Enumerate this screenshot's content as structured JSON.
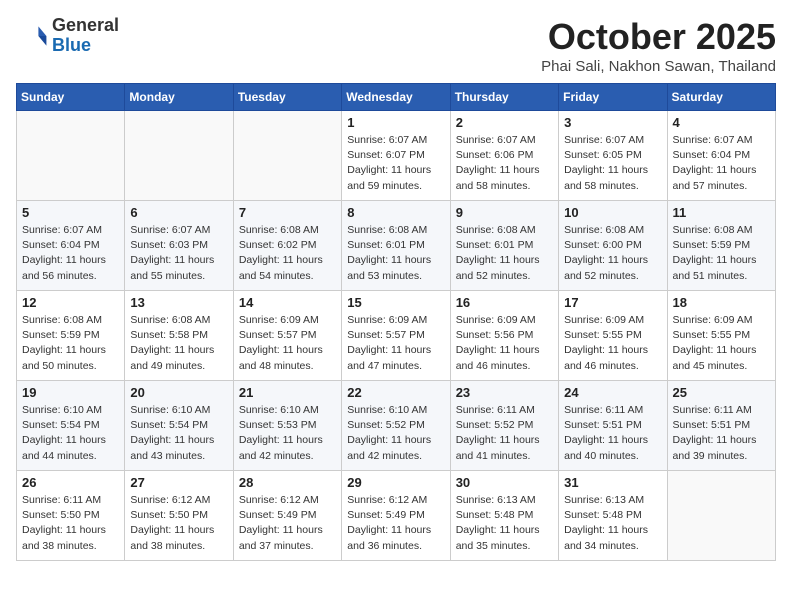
{
  "header": {
    "logo_general": "General",
    "logo_blue": "Blue",
    "month_title": "October 2025",
    "subtitle": "Phai Sali, Nakhon Sawan, Thailand"
  },
  "weekdays": [
    "Sunday",
    "Monday",
    "Tuesday",
    "Wednesday",
    "Thursday",
    "Friday",
    "Saturday"
  ],
  "weeks": [
    [
      {
        "day": "",
        "sunrise": "",
        "sunset": "",
        "daylight": ""
      },
      {
        "day": "",
        "sunrise": "",
        "sunset": "",
        "daylight": ""
      },
      {
        "day": "",
        "sunrise": "",
        "sunset": "",
        "daylight": ""
      },
      {
        "day": "1",
        "sunrise": "6:07 AM",
        "sunset": "6:07 PM",
        "daylight": "11 hours and 59 minutes."
      },
      {
        "day": "2",
        "sunrise": "6:07 AM",
        "sunset": "6:06 PM",
        "daylight": "11 hours and 58 minutes."
      },
      {
        "day": "3",
        "sunrise": "6:07 AM",
        "sunset": "6:05 PM",
        "daylight": "11 hours and 58 minutes."
      },
      {
        "day": "4",
        "sunrise": "6:07 AM",
        "sunset": "6:04 PM",
        "daylight": "11 hours and 57 minutes."
      }
    ],
    [
      {
        "day": "5",
        "sunrise": "6:07 AM",
        "sunset": "6:04 PM",
        "daylight": "11 hours and 56 minutes."
      },
      {
        "day": "6",
        "sunrise": "6:07 AM",
        "sunset": "6:03 PM",
        "daylight": "11 hours and 55 minutes."
      },
      {
        "day": "7",
        "sunrise": "6:08 AM",
        "sunset": "6:02 PM",
        "daylight": "11 hours and 54 minutes."
      },
      {
        "day": "8",
        "sunrise": "6:08 AM",
        "sunset": "6:01 PM",
        "daylight": "11 hours and 53 minutes."
      },
      {
        "day": "9",
        "sunrise": "6:08 AM",
        "sunset": "6:01 PM",
        "daylight": "11 hours and 52 minutes."
      },
      {
        "day": "10",
        "sunrise": "6:08 AM",
        "sunset": "6:00 PM",
        "daylight": "11 hours and 52 minutes."
      },
      {
        "day": "11",
        "sunrise": "6:08 AM",
        "sunset": "5:59 PM",
        "daylight": "11 hours and 51 minutes."
      }
    ],
    [
      {
        "day": "12",
        "sunrise": "6:08 AM",
        "sunset": "5:59 PM",
        "daylight": "11 hours and 50 minutes."
      },
      {
        "day": "13",
        "sunrise": "6:08 AM",
        "sunset": "5:58 PM",
        "daylight": "11 hours and 49 minutes."
      },
      {
        "day": "14",
        "sunrise": "6:09 AM",
        "sunset": "5:57 PM",
        "daylight": "11 hours and 48 minutes."
      },
      {
        "day": "15",
        "sunrise": "6:09 AM",
        "sunset": "5:57 PM",
        "daylight": "11 hours and 47 minutes."
      },
      {
        "day": "16",
        "sunrise": "6:09 AM",
        "sunset": "5:56 PM",
        "daylight": "11 hours and 46 minutes."
      },
      {
        "day": "17",
        "sunrise": "6:09 AM",
        "sunset": "5:55 PM",
        "daylight": "11 hours and 46 minutes."
      },
      {
        "day": "18",
        "sunrise": "6:09 AM",
        "sunset": "5:55 PM",
        "daylight": "11 hours and 45 minutes."
      }
    ],
    [
      {
        "day": "19",
        "sunrise": "6:10 AM",
        "sunset": "5:54 PM",
        "daylight": "11 hours and 44 minutes."
      },
      {
        "day": "20",
        "sunrise": "6:10 AM",
        "sunset": "5:54 PM",
        "daylight": "11 hours and 43 minutes."
      },
      {
        "day": "21",
        "sunrise": "6:10 AM",
        "sunset": "5:53 PM",
        "daylight": "11 hours and 42 minutes."
      },
      {
        "day": "22",
        "sunrise": "6:10 AM",
        "sunset": "5:52 PM",
        "daylight": "11 hours and 42 minutes."
      },
      {
        "day": "23",
        "sunrise": "6:11 AM",
        "sunset": "5:52 PM",
        "daylight": "11 hours and 41 minutes."
      },
      {
        "day": "24",
        "sunrise": "6:11 AM",
        "sunset": "5:51 PM",
        "daylight": "11 hours and 40 minutes."
      },
      {
        "day": "25",
        "sunrise": "6:11 AM",
        "sunset": "5:51 PM",
        "daylight": "11 hours and 39 minutes."
      }
    ],
    [
      {
        "day": "26",
        "sunrise": "6:11 AM",
        "sunset": "5:50 PM",
        "daylight": "11 hours and 38 minutes."
      },
      {
        "day": "27",
        "sunrise": "6:12 AM",
        "sunset": "5:50 PM",
        "daylight": "11 hours and 38 minutes."
      },
      {
        "day": "28",
        "sunrise": "6:12 AM",
        "sunset": "5:49 PM",
        "daylight": "11 hours and 37 minutes."
      },
      {
        "day": "29",
        "sunrise": "6:12 AM",
        "sunset": "5:49 PM",
        "daylight": "11 hours and 36 minutes."
      },
      {
        "day": "30",
        "sunrise": "6:13 AM",
        "sunset": "5:48 PM",
        "daylight": "11 hours and 35 minutes."
      },
      {
        "day": "31",
        "sunrise": "6:13 AM",
        "sunset": "5:48 PM",
        "daylight": "11 hours and 34 minutes."
      },
      {
        "day": "",
        "sunrise": "",
        "sunset": "",
        "daylight": ""
      }
    ]
  ],
  "labels": {
    "sunrise": "Sunrise:",
    "sunset": "Sunset:",
    "daylight": "Daylight:"
  }
}
